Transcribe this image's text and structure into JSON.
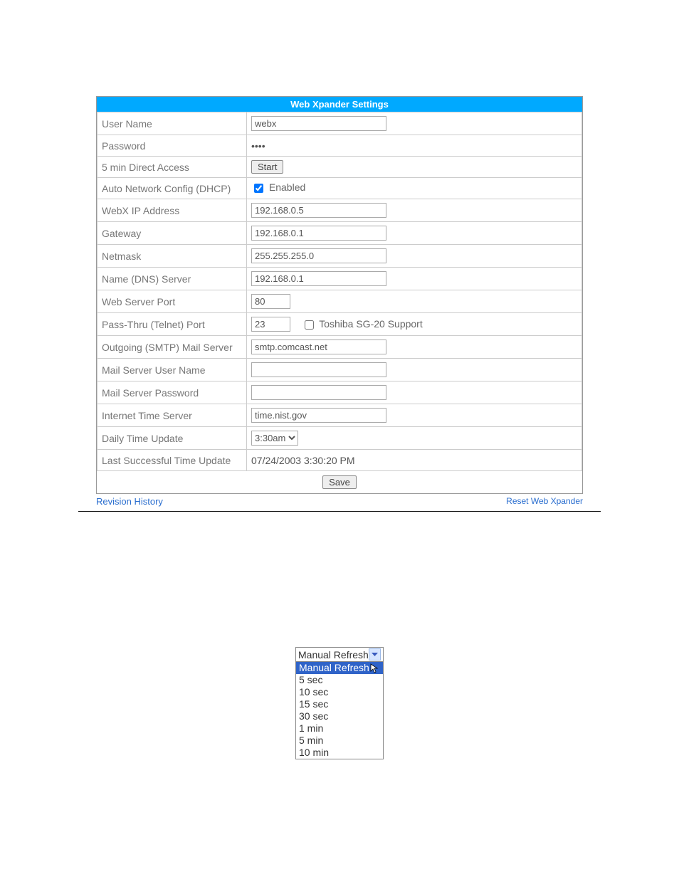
{
  "panel": {
    "title": "Web Xpander Settings",
    "rows": {
      "user_name": {
        "label": "User Name",
        "value": "webx"
      },
      "password": {
        "label": "Password",
        "value": "••••"
      },
      "direct_access": {
        "label": "5 min Direct Access",
        "button": "Start"
      },
      "dhcp": {
        "label": "Auto Network Config (DHCP)",
        "checkbox_label": "Enabled",
        "checked": true
      },
      "ip": {
        "label": "WebX IP Address",
        "value": "192.168.0.5"
      },
      "gateway": {
        "label": "Gateway",
        "value": "192.168.0.1"
      },
      "netmask": {
        "label": "Netmask",
        "value": "255.255.255.0"
      },
      "dns": {
        "label": "Name (DNS) Server",
        "value": "192.168.0.1"
      },
      "web_port": {
        "label": "Web Server Port",
        "value": "80"
      },
      "telnet": {
        "label": "Pass-Thru (Telnet) Port",
        "value": "23",
        "checkbox_label": "Toshiba SG-20 Support",
        "checked": false
      },
      "smtp": {
        "label": "Outgoing (SMTP) Mail Server",
        "value": "smtp.comcast.net"
      },
      "mail_user": {
        "label": "Mail Server User Name",
        "value": ""
      },
      "mail_pass": {
        "label": "Mail Server Password",
        "value": ""
      },
      "time_server": {
        "label": "Internet Time Server",
        "value": "time.nist.gov"
      },
      "time_update": {
        "label": "Daily Time Update",
        "value": "3:30am"
      },
      "last_update": {
        "label": "Last Successful Time Update",
        "value": "07/24/2003 3:30:20 PM"
      }
    },
    "save": "Save",
    "footer": {
      "left": "Revision History",
      "right": "Reset Web Xpander"
    }
  },
  "dropdown": {
    "selected": "Manual Refresh",
    "options": [
      "Manual Refresh",
      "5 sec",
      "10 sec",
      "15 sec",
      "30 sec",
      "1 min",
      "5 min",
      "10 min"
    ]
  }
}
